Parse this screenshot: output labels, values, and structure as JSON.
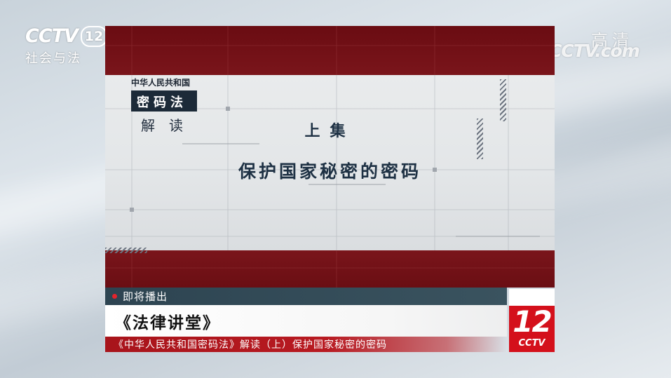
{
  "channel_logo": {
    "brand": "CCTV",
    "number": "12",
    "name": "社会与法"
  },
  "hd_logo": {
    "quality": "高清",
    "site": "CCTV.com"
  },
  "card": {
    "law_title_line1": "中华人民共和国",
    "law_title_line2": "密码法",
    "law_title_line3": "解读",
    "episode": "上集",
    "episode_title": "保护国家秘密的密码"
  },
  "lower_third": {
    "coming_up": "即将播出",
    "program_name": "《法律讲堂》",
    "description": "《中华人民共和国密码法》解读（上）保护国家秘密的密码"
  },
  "corner_logo": {
    "number": "12",
    "brand": "CCTV"
  },
  "colors": {
    "card_red": "#6d0f14",
    "accent_red": "#d4101b",
    "dark_teal": "#2d4451",
    "title_navy": "#1e3144"
  }
}
